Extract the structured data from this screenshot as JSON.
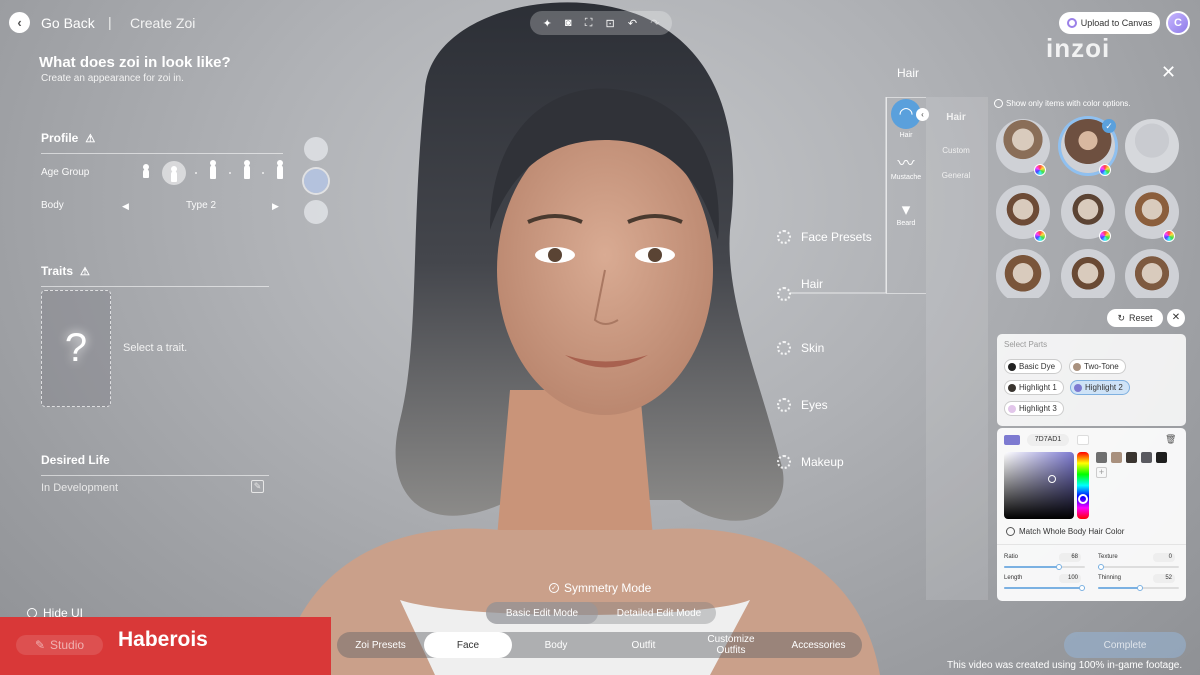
{
  "header": {
    "back_icon": "chevron-left-icon",
    "go_back": "Go Back",
    "separator": "|",
    "crumb": "Create Zoi"
  },
  "intro": {
    "title": "What does zoi in look like?",
    "subtitle": "Create an appearance for zoi in."
  },
  "profile": {
    "title": "Profile",
    "age_label": "Age Group",
    "body_label": "Body",
    "body_value": "Type 2"
  },
  "traits": {
    "title": "Traits",
    "placeholder": "Select a trait.",
    "card_symbol": "?"
  },
  "desired_life": {
    "title": "Desired Life",
    "status": "In Development"
  },
  "toolbar": {
    "icons": [
      "sparkle-icon",
      "camera-icon",
      "frame-icon",
      "face-scan-icon",
      "undo-icon",
      "redo-icon"
    ]
  },
  "upload": {
    "label": "Upload to Canvas"
  },
  "avatar": {
    "letter": "C"
  },
  "logo": "inzoi",
  "parts": [
    "Face Presets",
    "Hair",
    "Skin",
    "Eyes",
    "Makeup"
  ],
  "hair_panel": {
    "title": "Hair",
    "categories": [
      {
        "label": "Hair"
      },
      {
        "label": "Mustache"
      },
      {
        "label": "Beard"
      }
    ],
    "subcategories": [
      "Hair",
      "Custom",
      "General"
    ],
    "show_only": "Show only items with color options.",
    "reset": "Reset",
    "select_parts_label": "Select Parts",
    "parts": [
      "Basic Dye",
      "Two-Tone",
      "Highlight 1",
      "Highlight 2",
      "Highlight 3"
    ],
    "color": {
      "hex": "7D7AD1",
      "current": "#7D7AD1"
    },
    "match": "Match Whole Body Hair Color",
    "sliders": [
      {
        "label": "Ratio",
        "value": "68"
      },
      {
        "label": "Texture",
        "value": "0"
      },
      {
        "label": "Length",
        "value": "100"
      },
      {
        "label": "Thinning",
        "value": "52"
      }
    ]
  },
  "bottom": {
    "symmetry": "Symmetry Mode",
    "modes": [
      "Basic Edit Mode",
      "Detailed Edit Mode"
    ],
    "tabs": [
      "Zoi Presets",
      "Face",
      "Body",
      "Outfit",
      "Customize Outfits",
      "Accessories"
    ],
    "hide_ui": "Hide UI",
    "studio": "Studio",
    "complete": "Complete",
    "watermark": "Haberois",
    "footage_note": "This video was created using 100% in-game footage."
  }
}
